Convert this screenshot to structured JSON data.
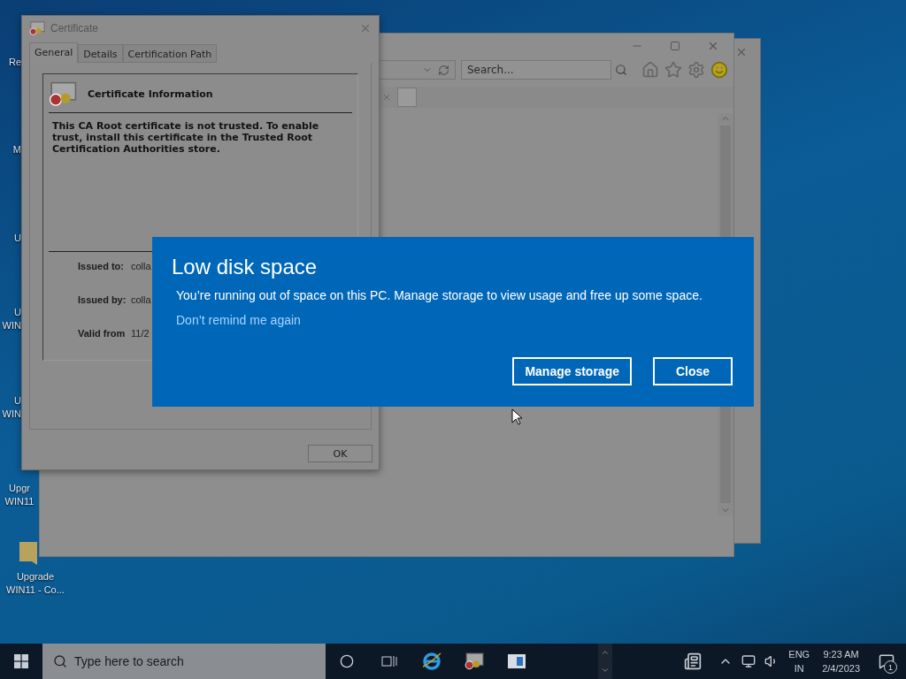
{
  "desktop_icons": [
    {
      "lines": [
        "Re"
      ]
    },
    {
      "lines": [
        "M"
      ]
    },
    {
      "lines": [
        "U"
      ]
    },
    {
      "lines": [
        "U",
        "WIN"
      ]
    },
    {
      "lines": [
        "U",
        "WIN"
      ]
    },
    {
      "lines": [
        "Upgr",
        "WIN11"
      ]
    },
    {
      "lines": [
        "Upgrade",
        "WIN11 - Co..."
      ]
    }
  ],
  "browser": {
    "search": {
      "placeholder": "Search..."
    }
  },
  "certificate": {
    "title": "Certificate",
    "tabs": [
      {
        "label": "General",
        "selected": true
      },
      {
        "label": "Details",
        "selected": false
      },
      {
        "label": "Certification Path",
        "selected": false
      }
    ],
    "heading": "Certificate Information",
    "message": "This CA Root certificate is not trusted. To enable trust, install this certificate in the Trusted Root Certification Authorities store.",
    "fields": [
      {
        "label": "Issued to:",
        "value": "colla"
      },
      {
        "label": "Issued by:",
        "value": "colla"
      },
      {
        "label": "Valid from",
        "value": "11/2"
      }
    ],
    "ok_button": "OK"
  },
  "toast": {
    "title": "Low disk space",
    "message": "You’re running out of space on this PC. Manage storage to view usage and free up some space.",
    "link": "Don’t remind me again",
    "buttons": [
      "Manage storage",
      "Close"
    ]
  },
  "taskbar": {
    "search": {
      "placeholder": "Type here to search"
    },
    "language": [
      "ENG",
      "IN"
    ],
    "time": "9:23 AM",
    "date": "2/4/2023",
    "notification_count": "1"
  }
}
